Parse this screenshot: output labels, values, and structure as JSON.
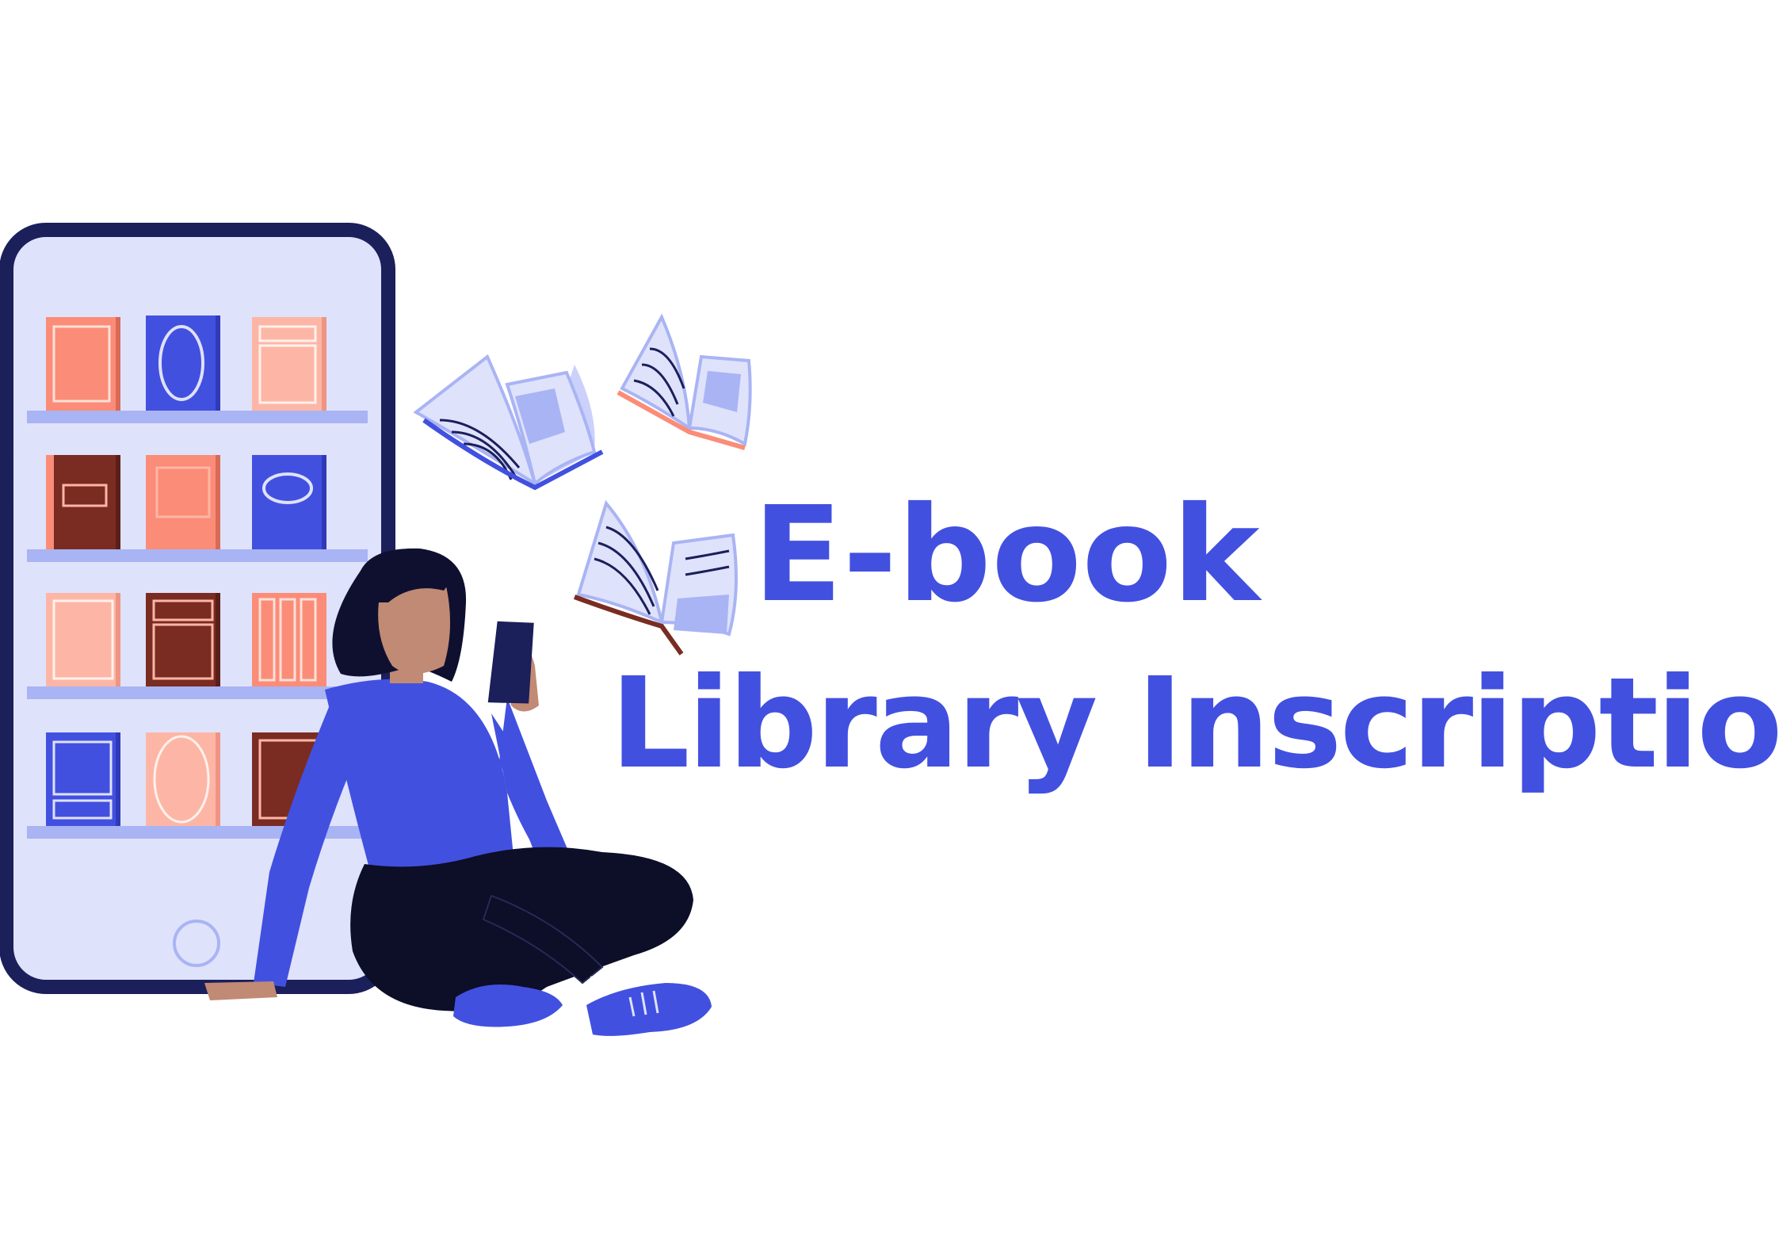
{
  "title": {
    "line1": "E-book",
    "line2": "Library Inscription"
  },
  "colors": {
    "accent": "#4250e0",
    "phone_frame": "#1b1f5a",
    "phone_screen": "#dfe2fb",
    "shelf": "#a9b4f4",
    "book_salmon": "#fb8c78",
    "book_blue": "#4250e0",
    "book_pink": "#fdb6a6",
    "book_brown": "#7a2c22",
    "skin": "#c08a74",
    "hair": "#0f1030",
    "pants": "#0d0e27"
  }
}
